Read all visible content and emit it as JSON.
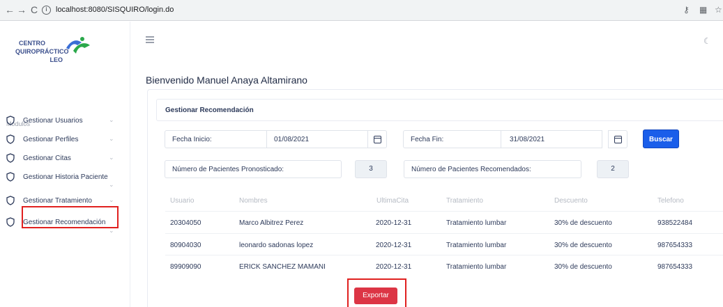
{
  "browser": {
    "back": "←",
    "forward": "→",
    "reload": "C",
    "url": "localhost:8080/SISQUIRO/login.do"
  },
  "logo": {
    "line1": "CENTRO",
    "line2": "QUIROPRÁCTICO",
    "line3": "LEO"
  },
  "sidebar": {
    "section": "Módulos",
    "items": [
      {
        "label": "Gestionar Usuarios"
      },
      {
        "label": "Gestionar Perfiles"
      },
      {
        "label": "Gestionar Citas"
      },
      {
        "label": "Gestionar Historia Paciente"
      },
      {
        "label": "Gestionar Tratamiento"
      },
      {
        "label": "Gestionar Recomendación"
      }
    ]
  },
  "header": {
    "welcome": "Bienvenido Manuel Anaya Altamirano"
  },
  "card": {
    "title": "Gestionar Recomendación",
    "fecha_inicio_label": "Fecha Inicio:",
    "fecha_inicio_value": "01/08/2021",
    "fecha_fin_label": "Fecha Fin:",
    "fecha_fin_value": "31/08/2021",
    "buscar": "Buscar",
    "pronosticado_label": "Número de Pacientes Pronosticado:",
    "pronosticado_value": "3",
    "recomendados_label": "Número de Pacientes Recomendados:",
    "recomendados_value": "2",
    "exportar": "Exportar"
  },
  "table": {
    "headers": [
      "Usuario",
      "Nombres",
      "UltimaCita",
      "Tratamiento",
      "Descuento",
      "Telefono"
    ],
    "rows": [
      [
        "20304050",
        "Marco Albitrez Perez",
        "2020-12-31",
        "Tratamiento lumbar",
        "30% de descuento",
        "938522484"
      ],
      [
        "80904030",
        "leonardo sadonas lopez",
        "2020-12-31",
        "Tratamiento lumbar",
        "30% de descuento",
        "987654333"
      ],
      [
        "89909090",
        "ERICK SANCHEZ MAMANI",
        "2020-12-31",
        "Tratamiento lumbar",
        "30% de descuento",
        "987654333"
      ]
    ]
  },
  "colors": {
    "primary": "#1a5eea",
    "danger": "#dc3545",
    "highlight": "#e0201f"
  }
}
